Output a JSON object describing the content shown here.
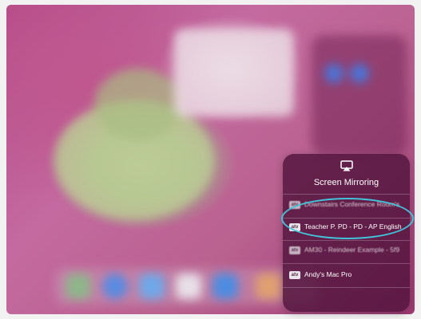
{
  "screen_mirroring": {
    "title": "Screen Mirroring",
    "icon": "airplay-icon",
    "devices": [
      {
        "label": "Downstairs Conference Room's",
        "badge": "atv"
      },
      {
        "label": "Teacher P. PD - PD - AP English",
        "badge": "atv"
      },
      {
        "label": "AM30 - Reindeer Example - 5f9",
        "badge": "atv"
      },
      {
        "label": "Andy's Mac Pro",
        "badge": "atv"
      }
    ]
  },
  "colors": {
    "highlight": "#43c3d9",
    "panel": "#50143c",
    "wallpaper": "#b54b88"
  }
}
